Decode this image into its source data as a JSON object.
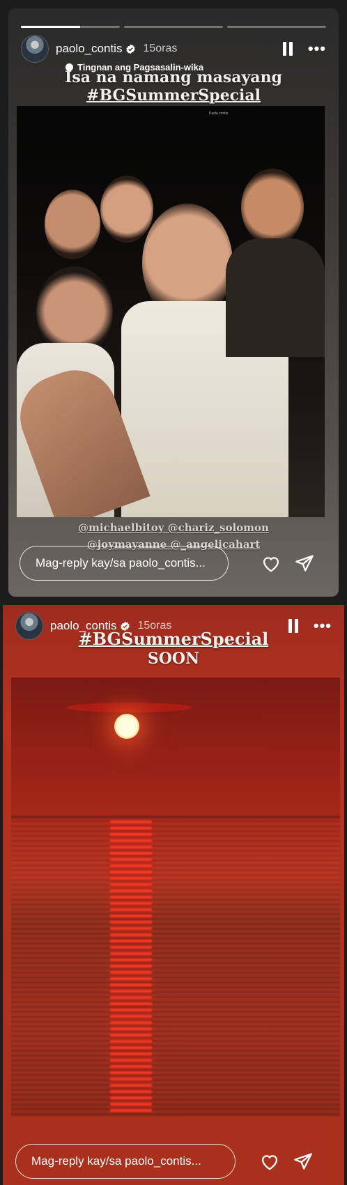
{
  "story1": {
    "progress": [
      0.6,
      0,
      0
    ],
    "username": "paolo_contis",
    "time": "15oras",
    "translate_label": "Tingnan ang Pagsasalin-wika",
    "caption_line1": "Isa na namang masayang",
    "caption_line2": "#BGSummerSpecial",
    "photo_tiny_text": "Paolo contis",
    "mentions_line1": "@michaelbitoy @chariz_solomon",
    "mentions_line2": "@joymayanne @_angelicahart",
    "reply_placeholder": "Mag-reply kay/sa paolo_contis..."
  },
  "story2": {
    "username": "paolo_contis",
    "time": "15oras",
    "caption_line1": "#BGSummerSpecial",
    "caption_line2": "SOON",
    "reply_placeholder": "Mag-reply kay/sa paolo_contis..."
  },
  "icons": {
    "verified": "verified-badge-icon",
    "pause": "pause-icon",
    "more": "more-options-icon",
    "like": "heart-icon",
    "share": "send-icon"
  },
  "colors": {
    "background": "#1c1c1c",
    "story2_bg": "#a8301d"
  }
}
